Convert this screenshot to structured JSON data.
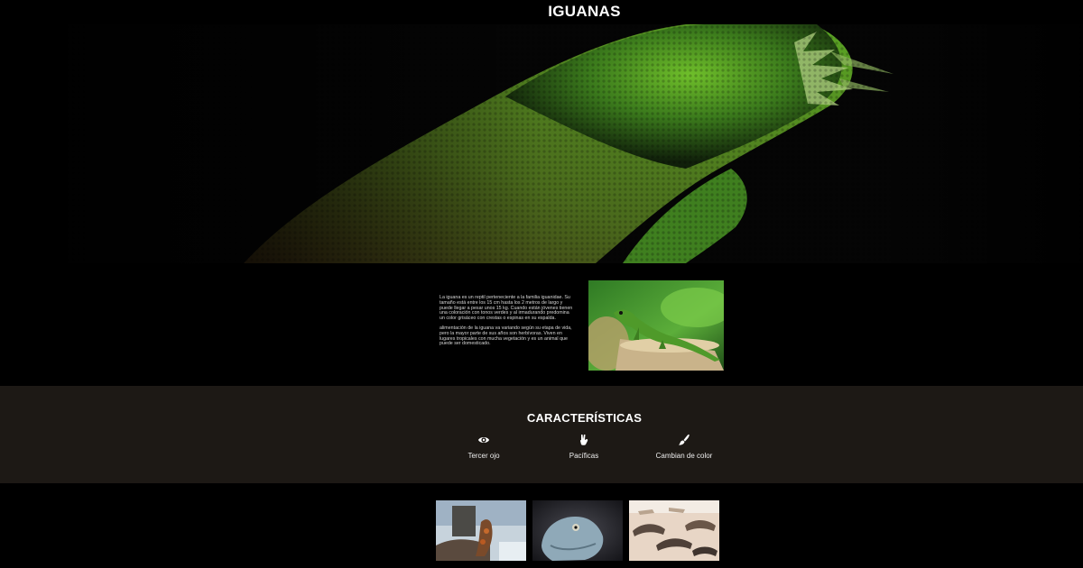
{
  "header": {
    "title": "IGUANAS"
  },
  "intro": {
    "paragraphs": [
      "La iguana es un reptil perteneciente a la familia iguanidae. Su tamaño está entre los 15 cm hasta los 2 metros de largo y puede llegar a pesar unos 15 kg. Cuando están jóvenes tienen una coloración con tonos verdes y al irmadurando predomina un color grisáceo con crestas o espinas en su espalda.",
      "alimentación de la iguana va variando según su etapa de vida, pero la mayor parte de sus años son herbívoras. Viven en lugares tropicales con mucha vegetación y es un animal que puede ser domesticado."
    ]
  },
  "features": {
    "title": "CARACTERÍSTICAS",
    "items": [
      {
        "icon": "eye-icon",
        "label": "Tercer ojo"
      },
      {
        "icon": "peace-hand-icon",
        "label": "Pacíficas"
      },
      {
        "icon": "paintbrush-icon",
        "label": "Cambian de color"
      }
    ]
  },
  "colors": {
    "background": "#000000",
    "features_band": "#1d1915",
    "text": "#ffffff"
  }
}
